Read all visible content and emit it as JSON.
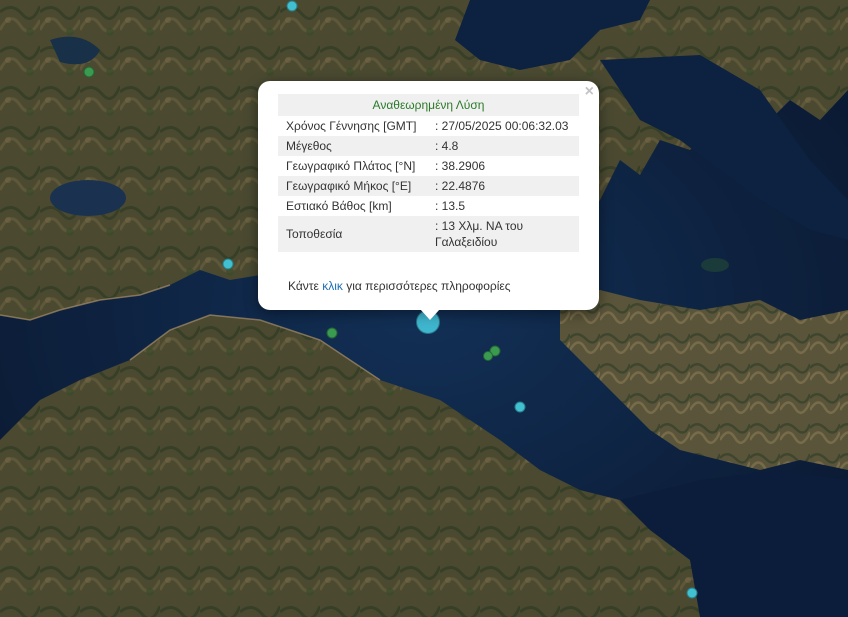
{
  "colors": {
    "sea": "#0d1f3a",
    "land": "#4a4a30",
    "marker_latest": "#3fb6cf",
    "marker_recent": "#40c0d0",
    "marker_older": "#3a9a50",
    "popup_title": "#2a7a2a",
    "link": "#1f6fb5"
  },
  "popup": {
    "title": "Αναθεωρημένη Λύση",
    "close_icon": "×",
    "rows": [
      {
        "label": "Χρόνος Γέννησης [GMT]",
        "value": ": 27/05/2025 00:06:32.03"
      },
      {
        "label": "Μέγεθος",
        "value": ": 4.8"
      },
      {
        "label": "Γεωγραφικό Πλάτος [°N]",
        "value": ": 38.2906"
      },
      {
        "label": "Γεωγραφικό Μήκος [°E]",
        "value": ": 22.4876"
      },
      {
        "label": "Εστιακό Βάθος [km]",
        "value": ": 13.5"
      },
      {
        "label": "Τοποθεσία",
        "value": ": 13 Χλμ. ΝΑ του Γαλαξειδίου"
      }
    ],
    "more_prefix": "Κάντε ",
    "more_link": "κλικ",
    "more_suffix": " για περισσότερες πληροφορίες"
  },
  "markers": [
    {
      "kind": "latest",
      "magnitude": 4.8
    },
    {
      "kind": "recent"
    },
    {
      "kind": "recent"
    },
    {
      "kind": "recent"
    },
    {
      "kind": "older"
    },
    {
      "kind": "older"
    },
    {
      "kind": "older"
    },
    {
      "kind": "older"
    }
  ]
}
